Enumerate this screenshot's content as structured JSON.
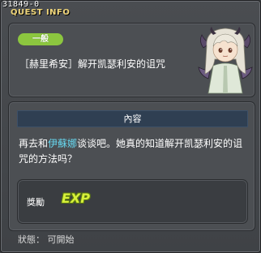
{
  "quest_id": "31849-0",
  "window_title": "QUEST INFO",
  "quest": {
    "category_badge": "一般",
    "name": "［赫里希安］解开凯瑟利安的诅咒"
  },
  "npc_portrait": "white-haired girl with bat wings",
  "content": {
    "header": "內容",
    "description_part1": "再去和",
    "npc_name": "伊蘇娜",
    "description_part2": "谈谈吧。她真的知道解开凯瑟利安的诅咒的方法吗？"
  },
  "reward": {
    "label": "獎勵",
    "exp_text": "EXP"
  },
  "status": "狀態：  可開始",
  "colors": {
    "badge": "#8cc63f",
    "npc_name": "#67d8f0",
    "title": "#f0d67a",
    "exp": "#d7f03a"
  }
}
